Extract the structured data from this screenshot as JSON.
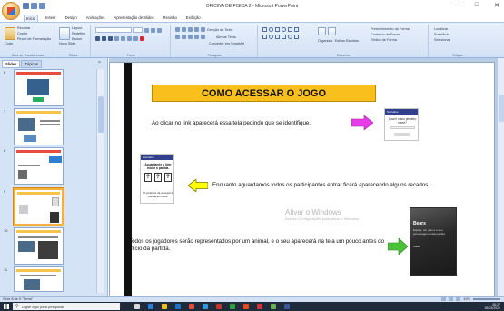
{
  "window": {
    "title": "OFICINA DE FISICA 2 - Microsoft PowerPoint",
    "controls": [
      "–",
      "□",
      "✕"
    ]
  },
  "ribbon_tabs": [
    "Início",
    "Inserir",
    "Design",
    "Animações",
    "Apresentação de Slides",
    "Revisão",
    "Exibição"
  ],
  "ribbon": {
    "clipboard": {
      "paste": "Colar",
      "cut": "Recortar",
      "copy": "Copiar",
      "format_painter": "Pincel de Formatação",
      "label": "Área de Transferência"
    },
    "slides": {
      "new_slide": "Novo Slide",
      "layout": "Layout",
      "reset": "Redefinir",
      "delete": "Excluir",
      "label": "Slides"
    },
    "font": {
      "label": "Fonte"
    },
    "paragraph": {
      "text_direction": "Direção do Texto",
      "align_text": "Alinhar Texto",
      "convert_smartart": "Converter em SmartArt",
      "label": "Parágrafo"
    },
    "drawing": {
      "arrange": "Organizar",
      "quick_styles": "Estilos Rápidos",
      "shape_fill": "Preenchimento da Forma",
      "shape_outline": "Contorno da Forma",
      "shape_effects": "Efeitos de Forma",
      "label": "Desenho"
    },
    "editing": {
      "find": "Localizar",
      "replace": "Substituir",
      "select": "Selecionar",
      "label": "Edição"
    }
  },
  "pane": {
    "tabs": [
      "Slides",
      "Tópicos"
    ],
    "close": "×",
    "slide_numbers": [
      "6",
      "7",
      "8",
      "9",
      "10",
      "11"
    ]
  },
  "slide": {
    "title": "COMO ACESSAR O JOGO",
    "text1": "Ao clicar no link aparecerá essa tela pedindo que se identifique.",
    "text2": "Enquanto aguardamos todos os participantes entrar ficará aparecendo alguns recados.",
    "text3": "Todos os jogadores serão representados por um animal, e o seu  aparecerá na tela um pouco antes do início da partida.",
    "phone1": {
      "header": "Socrative",
      "question": "Qual é o seu primeiro nome?",
      "button": ""
    },
    "phone2": {
      "header": "Socrative",
      "title": "Aguardando o líder iniciar a partida.",
      "boxes": [
        "?",
        "?",
        "?"
      ],
      "footer": "O professor irá começar a partida em breve"
    },
    "dark_card": {
      "name": "Bears",
      "desc": "Equipe: um urso é o seu personagem nesta partida.",
      "label": "Wear"
    }
  },
  "watermark": {
    "line1": "Ativar o Windows",
    "line2": "Acesse Configurações para ativar o Windows."
  },
  "statusbar": {
    "left": "Slide 8 de 9   \"Tema\"",
    "zoom": "48%"
  },
  "taskbar": {
    "search_placeholder": "Digite aqui para pesquisar",
    "time": "08:27",
    "date": "28/03/2021",
    "icons": [
      "#d9d9d9",
      "#2d7dd2",
      "#f0c020",
      "#1c74c9",
      "#e74c3c",
      "#3a96dd",
      "#c0392b",
      "#2aa147",
      "#e84a1e",
      "#d13438",
      "#6ab04c",
      "#3b5998"
    ]
  },
  "colors": {
    "title_fill": "#f9bf1d",
    "arrow_magenta": "#e63be6",
    "arrow_yellow": "#ffff00",
    "arrow_green": "#4cc23a"
  }
}
